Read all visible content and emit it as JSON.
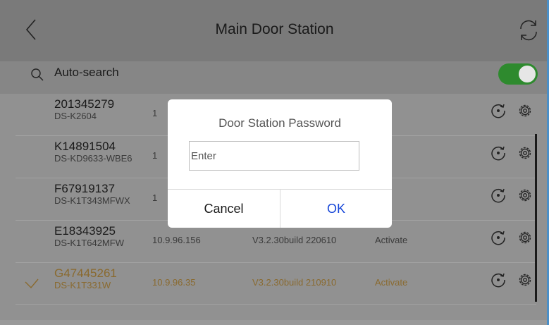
{
  "header": {
    "title": "Main Door Station",
    "back_icon": "chevron-left-icon",
    "refresh_icon": "refresh-icon"
  },
  "search": {
    "label": "Auto-search",
    "icon": "search-icon",
    "toggle_on": true,
    "toggle_color": "#2e8a2e"
  },
  "devices": [
    {
      "name": "201345279",
      "model": "DS-K2604",
      "ip": "1",
      "firmware": "",
      "status": "vate",
      "selected": false
    },
    {
      "name": "K14891504",
      "model": "DS-KD9633-WBE6",
      "ip": "1",
      "firmware": "",
      "status": "vate",
      "selected": false
    },
    {
      "name": "F67919137",
      "model": "DS-K1T343MFWX",
      "ip": "1",
      "firmware": "",
      "status": "vate",
      "selected": false
    },
    {
      "name": "E18343925",
      "model": "DS-K1T642MFW",
      "ip": "10.9.96.156",
      "firmware": "V3.2.30build 220610",
      "status": "Activate",
      "selected": false
    },
    {
      "name": "G47445261",
      "model": "DS-K1T331W",
      "ip": "10.9.96.35",
      "firmware": "V3.2.30build 210910",
      "status": "Activate",
      "selected": true
    }
  ],
  "dialog": {
    "title": "Door Station Password",
    "input_placeholder": "Enter",
    "input_value": "",
    "cancel_label": "Cancel",
    "ok_label": "OK",
    "ok_color": "#1646d8"
  }
}
